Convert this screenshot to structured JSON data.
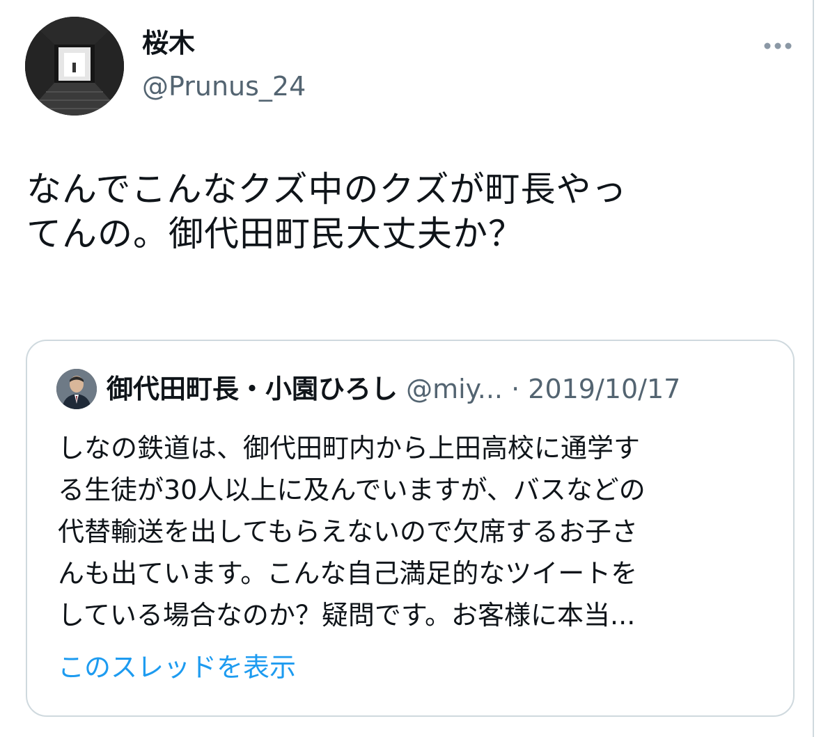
{
  "author": {
    "display_name": "桜木",
    "handle": "@Prunus_24",
    "avatar_icon": "profile-photo-stairway"
  },
  "menu": {
    "icon": "more-options-icon"
  },
  "tweet": {
    "lines": [
      "なんでこんなクズ中のクズが町長やっ",
      "てんの。御代田町民大丈夫か？"
    ]
  },
  "quoted": {
    "display_name": "御代田町長・小園ひろし",
    "handle": "@miy...",
    "separator": "·",
    "date": "2019/10/17",
    "avatar_icon": "profile-photo-man-in-suit",
    "lines": [
      "しなの鉄道は、御代田町内から上田高校に通学す",
      "る生徒が30人以上に及んでいますが、バスなどの",
      "代替輸送を出してもらえないので欠席するお子さ",
      "んも出ています。こんな自己満足的なツイートを",
      "している場合なのか？疑問です。お客様に本当..."
    ],
    "show_thread_label": "このスレッドを表示"
  },
  "colors": {
    "text": "#0f1419",
    "secondary": "#536471",
    "link": "#1d9bf0",
    "border": "#cfd9de"
  }
}
